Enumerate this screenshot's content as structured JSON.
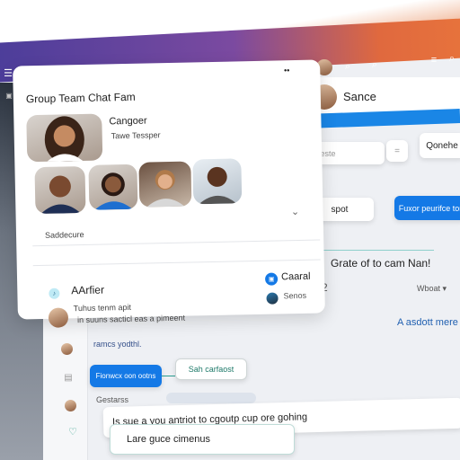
{
  "popup": {
    "title": "Group Team Chat Fam",
    "featured_name": "Cangoer",
    "featured_role": "Tawe Tessper",
    "section_label": "Saddecure",
    "author": "AArfier",
    "msg_line1": "Tuhus tenm apit",
    "msg_line2": "in suuns sacticl eas a pimeent",
    "action1": "Caaral",
    "action2": "Senos"
  },
  "header": {
    "user_name": "Sance"
  },
  "right": {
    "search_placeholder": "Cleste",
    "button_right": "Qonehe",
    "spot_button": "spot",
    "primary_button": "Fuxor peurifce tor",
    "heading": "Grate of to cam Nan!",
    "count": "2",
    "dropdown": "Wboat",
    "link": "A asdott mere"
  },
  "chat": {
    "line1": "ramcs yodthl.",
    "blue_bubble": "Fionwcx oon ootns",
    "outline_bubble": "Sah carfaost",
    "label": "Gestarss",
    "input_text": "Is sue a you antriot to cgoutp cup ore gohing",
    "suggestion": "Lare guce cimenus"
  },
  "colors": {
    "accent": "#1479e6",
    "teal": "#2a9d8f",
    "purple": "#4b3d9a",
    "orange": "#e8743c"
  }
}
